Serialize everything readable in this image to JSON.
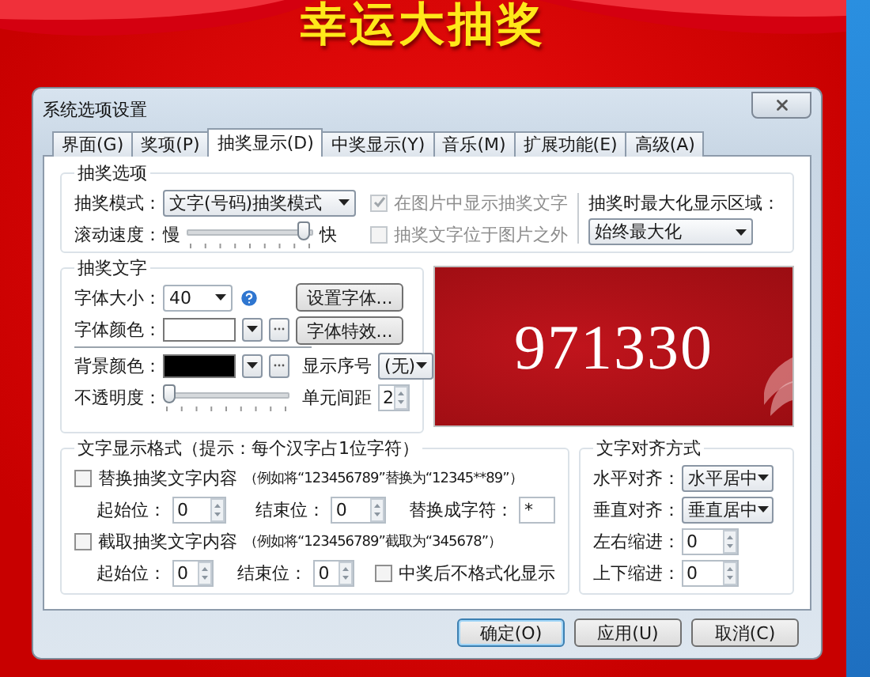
{
  "app": {
    "title": "幸运大抽奖"
  },
  "window": {
    "title": "系统选项设置"
  },
  "tabs": [
    {
      "label": "界面(G)",
      "selected": false
    },
    {
      "label": "奖项(P)",
      "selected": false
    },
    {
      "label": "抽奖显示(D)",
      "selected": true
    },
    {
      "label": "中奖显示(Y)",
      "selected": false
    },
    {
      "label": "音乐(M)",
      "selected": false
    },
    {
      "label": "扩展功能(E)",
      "selected": false
    },
    {
      "label": "高级(A)",
      "selected": false
    }
  ],
  "draw_options": {
    "title": "抽奖选项",
    "mode": {
      "label": "抽奖模式：",
      "value": "文字(号码)抽奖模式"
    },
    "speed": {
      "label": "滚动速度：",
      "min_label": "慢",
      "max_label": "快",
      "level": 0.92
    },
    "checkboxes": [
      {
        "label": "在图片中显示抽奖文字",
        "checked": true,
        "disabled": true
      },
      {
        "label": "抽奖文字位于图片之外",
        "checked": false,
        "disabled": true
      }
    ],
    "maximize": {
      "label": "抽奖时最大化显示区域：",
      "value": "始终最大化"
    }
  },
  "draw_text": {
    "title": "抽奖文字",
    "font_size": {
      "label": "字体大小：",
      "value": "40"
    },
    "font_color": {
      "label": "字体颜色：",
      "color": "#ffffff"
    },
    "set_font_button": "设置字体...",
    "font_effect_button": "字体特效...",
    "bg_color": {
      "label": "背景颜色：",
      "color": "#000000"
    },
    "show_index": {
      "label": "显示序号",
      "value": "(无)"
    },
    "opacity": {
      "label": "不透明度：",
      "level": 0.05
    },
    "cell_spacing": {
      "label": "单元间距",
      "value": "2"
    }
  },
  "preview": {
    "number": "971330"
  },
  "format": {
    "title": "文字显示格式（提示：每个汉字占1位字符）",
    "replace": {
      "label": "替换抽奖文字内容",
      "checked": false,
      "example": "（例如将“123456789”替换为“12345**89”）",
      "start_label": "起始位：",
      "start": "0",
      "end_label": "结束位：",
      "end": "0",
      "char_label": "替换成字符：",
      "char": "*"
    },
    "cut": {
      "label": "截取抽奖文字内容",
      "checked": false,
      "example": "（例如将“123456789”截取为“345678”）",
      "start_label": "起始位：",
      "start": "0",
      "end_label": "结束位：",
      "end": "0"
    },
    "no_format": {
      "label": "中奖后不格式化显示",
      "checked": false
    }
  },
  "align": {
    "title": "文字对齐方式",
    "horizontal": {
      "label": "水平对齐：",
      "value": "水平居中"
    },
    "vertical": {
      "label": "垂直对齐：",
      "value": "垂直居中"
    },
    "lr_indent": {
      "label": "左右缩进：",
      "value": "0"
    },
    "tb_indent": {
      "label": "上下缩进：",
      "value": "0"
    }
  },
  "buttons": [
    {
      "label": "确定(O)",
      "default": true
    },
    {
      "label": "应用(U)",
      "default": false
    },
    {
      "label": "取消(C)",
      "default": false
    }
  ]
}
